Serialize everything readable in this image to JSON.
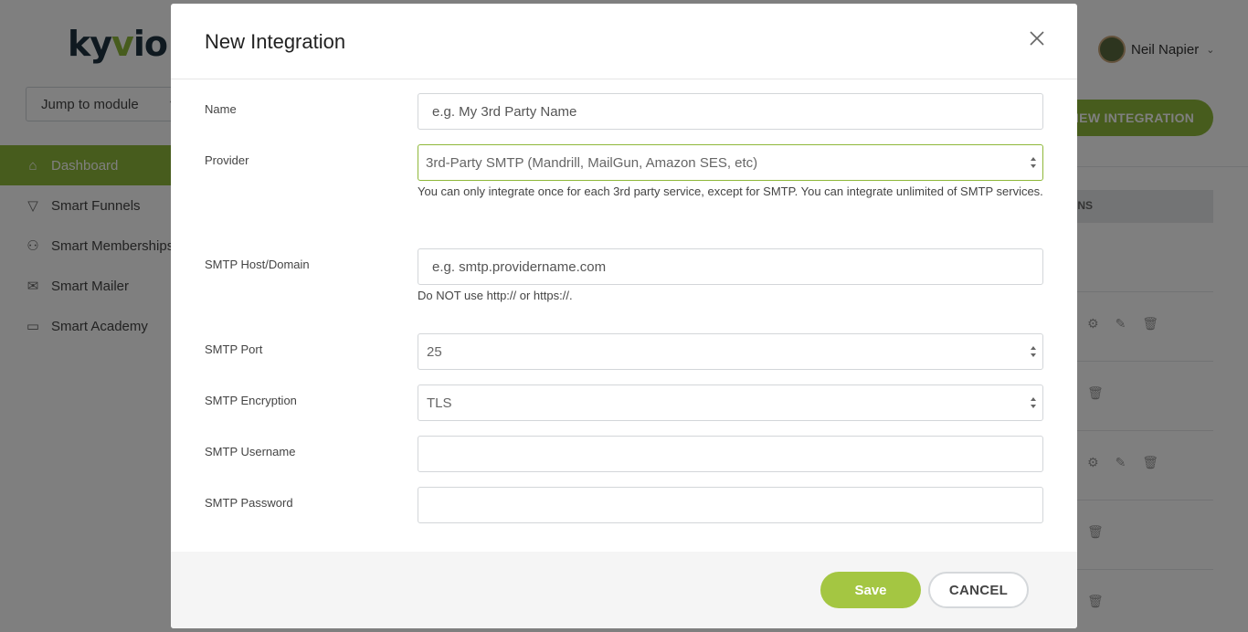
{
  "app": {
    "logo_text_1": "ky",
    "logo_accent": "v",
    "logo_text_2": "io",
    "jump_label": "Jump to module",
    "user_name": "Neil Napier",
    "new_integration_label": "NEW INTEGRATION",
    "table_header_partial": "ONS",
    "nav": [
      {
        "label": "Dashboard",
        "icon": "home-icon",
        "active": true
      },
      {
        "label": "Smart Funnels",
        "icon": "funnel-icon"
      },
      {
        "label": "Smart Memberships",
        "icon": "users-icon"
      },
      {
        "label": "Smart Mailer",
        "icon": "mail-icon"
      },
      {
        "label": "Smart Academy",
        "icon": "monitor-icon"
      }
    ]
  },
  "modal": {
    "title": "New Integration",
    "fields": {
      "name": {
        "label": "Name",
        "placeholder": "e.g. My 3rd Party Name"
      },
      "provider": {
        "label": "Provider",
        "value": "3rd-Party SMTP (Mandrill, MailGun, Amazon SES, etc)",
        "help": "You can only integrate once for each 3rd party service, except for SMTP. You can integrate unlimited of SMTP services."
      },
      "host": {
        "label": "SMTP Host/Domain",
        "placeholder": "e.g. smtp.providername.com",
        "help": "Do NOT use http:// or https://."
      },
      "port": {
        "label": "SMTP Port",
        "value": "25"
      },
      "encryption": {
        "label": "SMTP Encryption",
        "value": "TLS"
      },
      "username": {
        "label": "SMTP Username",
        "value": ""
      },
      "password": {
        "label": "SMTP Password",
        "value": ""
      }
    },
    "save_label": "Save",
    "cancel_label": "CANCEL"
  },
  "colors": {
    "brand_green": "#8fb83a",
    "save_green": "#a4c642",
    "focus_border": "#8fb83a"
  }
}
